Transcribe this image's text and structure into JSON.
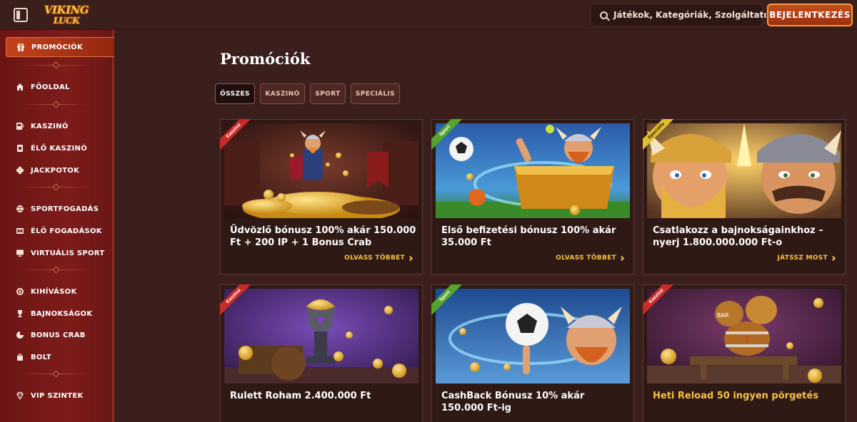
{
  "header": {
    "logo_line1": "VIKING",
    "logo_line2": "LUCK",
    "search_placeholder": "Játékok, Kategóriák, Szolgáltatók",
    "login_label": "BEJELENTKEZÉS"
  },
  "sidebar": {
    "items": [
      {
        "label": "PROMÓCIÓK",
        "icon": "gift-icon",
        "active": true
      },
      {
        "label": "FŐOLDAL",
        "icon": "home-icon"
      },
      {
        "label": "KASZINÓ",
        "icon": "slot-machine-icon"
      },
      {
        "label": "ÉLŐ KASZINÓ",
        "icon": "cards-icon"
      },
      {
        "label": "JACKPOTOK",
        "icon": "clover-icon"
      },
      {
        "label": "SPORTFOGADÁS",
        "icon": "ball-icon"
      },
      {
        "label": "ÉLŐ FOGADÁSOK",
        "icon": "scoreboard-icon"
      },
      {
        "label": "VIRTUÁLIS SPORT",
        "icon": "monitor-icon"
      },
      {
        "label": "KIHÍVÁSOK",
        "icon": "target-icon"
      },
      {
        "label": "BAJNOKSÁGOK",
        "icon": "trophy-icon"
      },
      {
        "label": "BONUS CRAB",
        "icon": "crab-icon"
      },
      {
        "label": "BOLT",
        "icon": "bag-icon"
      },
      {
        "label": "VIP SZINTEK",
        "icon": "diamond-icon"
      }
    ]
  },
  "main": {
    "title": "Promóciók",
    "filters": [
      "ÖSSZES",
      "KASZINÓ",
      "SPORT",
      "SPECIÁLIS"
    ],
    "active_filter": "ÖSSZES",
    "cards": [
      {
        "tag": "Kaszinó",
        "title": "Üdvözlő bónusz 100% akár 150.000 Ft + 200 IP + 1 Bonus Crab",
        "cta": "OLVASS TÖBBET"
      },
      {
        "tag": "Sport",
        "title": "Első befizetési bónusz 100% akár 35.000 Ft",
        "cta": "OLVASS TÖBBET"
      },
      {
        "tag": "Speciális",
        "title": "Csatlakozz a bajnokságainkhoz – nyerj 1.800.000.000 Ft-o",
        "cta": "JÁTSSZ MOST"
      },
      {
        "tag": "Kaszinó",
        "title": "Rulett Roham 2.400.000 Ft",
        "cta": ""
      },
      {
        "tag": "Sport",
        "title": "CashBack Bónusz 10% akár 150.000 Ft-ig",
        "cta": ""
      },
      {
        "tag": "Kaszinó",
        "title": "Heti Reload 50 ingyen pörgetés",
        "cta": ""
      }
    ]
  },
  "colors": {
    "background": "#3a1f1c",
    "sidebar": "#7d1c19",
    "accent_gold": "#f6c243",
    "login_button": "#b73e17",
    "tag_casino": "#c92b28",
    "tag_sport": "#55a52c",
    "tag_special": "#e1bf2c"
  }
}
